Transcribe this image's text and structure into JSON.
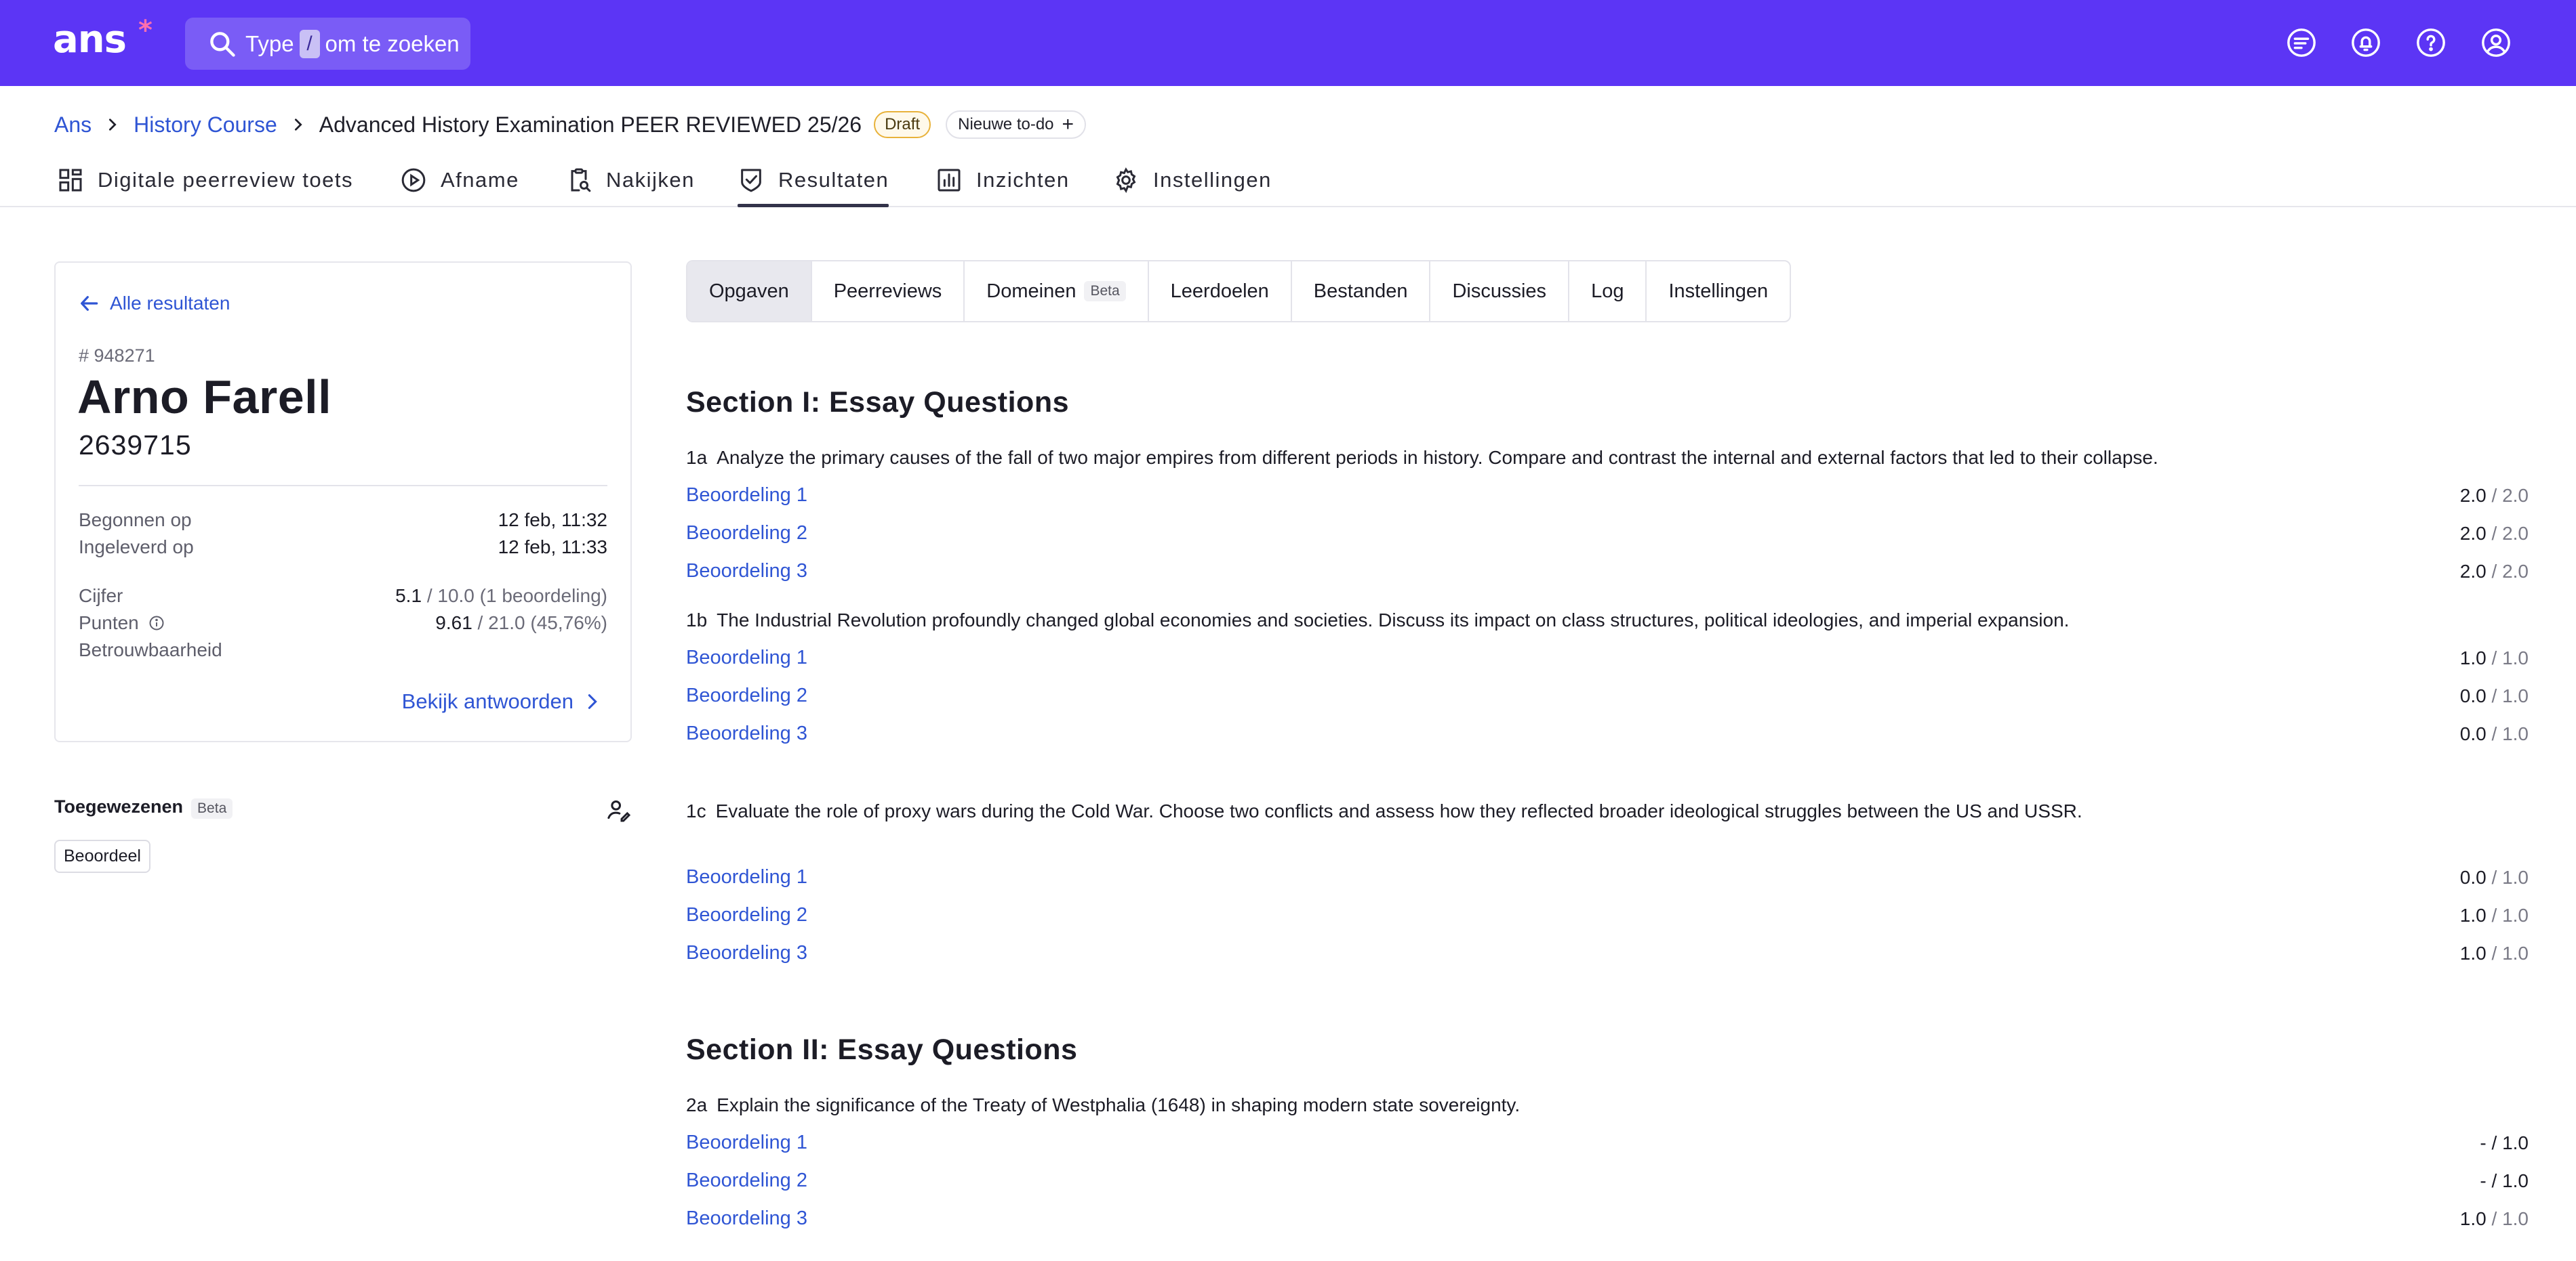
{
  "topbar": {
    "logo": "ans",
    "logo_star": "*",
    "search_prefix": "Type",
    "search_key": "/",
    "search_suffix": "om te zoeken",
    "brand_color": "#5c35f5",
    "icons": [
      "feedback-icon",
      "notifications-icon",
      "help-icon",
      "account-icon"
    ]
  },
  "breadcrumb": {
    "root": "Ans",
    "course": "History Course",
    "current": "Advanced History Examination PEER REVIEWED 25/26",
    "status": "Draft",
    "todo_label": "Nieuwe to-do",
    "todo_plus": "+"
  },
  "nav": {
    "items": [
      {
        "label": "Digitale peerreview toets",
        "icon": "grid-icon"
      },
      {
        "label": "Afname",
        "icon": "play-icon"
      },
      {
        "label": "Nakijken",
        "icon": "clipboard-search-icon"
      },
      {
        "label": "Resultaten",
        "icon": "shield-check-icon"
      },
      {
        "label": "Inzichten",
        "icon": "bar-chart-icon"
      },
      {
        "label": "Instellingen",
        "icon": "gear-icon"
      }
    ],
    "active": "Resultaten"
  },
  "student": {
    "back_label": "Alle resultaten",
    "id": "# 948271",
    "name": "Arno Farell",
    "number": "2639715",
    "started_label": "Begonnen op",
    "started_value": "12 feb, 11:32",
    "submitted_label": "Ingeleverd op",
    "submitted_value": "12 feb, 11:33",
    "grade_label": "Cijfer",
    "grade_value": "5.1",
    "grade_rest": "/ 10.0 (1 beoordeling)",
    "points_label": "Punten",
    "points_value": "9.61",
    "points_rest": "/ 21.0 (45,76%)",
    "reliability_label": "Betrouwbaarheid",
    "view_answers": "Bekijk antwoorden"
  },
  "assigned": {
    "title": "Toegewezenen",
    "beta": "Beta",
    "chip": "Beoordeel"
  },
  "tabs": {
    "items": [
      "Opgaven",
      "Peerreviews",
      "Domeinen",
      "Leerdoelen",
      "Bestanden",
      "Discussies",
      "Log",
      "Instellingen"
    ],
    "domain_badge": "Beta",
    "active": "Opgaven"
  },
  "sections": [
    {
      "title": "Section I: Essay Questions",
      "questions": [
        {
          "num": "1a",
          "text": "Analyze the primary causes of the fall of two major empires from different periods in history. Compare and contrast the internal and external factors that led to their collapse.",
          "reviews": [
            {
              "label": "Beoordeling 1",
              "score": "2.0",
              "max": "/ 2.0"
            },
            {
              "label": "Beoordeling 2",
              "score": "2.0",
              "max": "/ 2.0"
            },
            {
              "label": "Beoordeling 3",
              "score": "2.0",
              "max": "/ 2.0"
            }
          ]
        },
        {
          "num": "1b",
          "text": "The Industrial Revolution profoundly changed global economies and societies. Discuss its impact on class structures, political ideologies, and imperial expansion.",
          "reviews": [
            {
              "label": "Beoordeling 1",
              "score": "1.0",
              "max": "/ 1.0"
            },
            {
              "label": "Beoordeling 2",
              "score": "0.0",
              "max": "/ 1.0"
            },
            {
              "label": "Beoordeling 3",
              "score": "0.0",
              "max": "/ 1.0"
            }
          ]
        },
        {
          "num": "1c",
          "text": "Evaluate the role of proxy wars during the Cold War. Choose two conflicts and assess how they reflected broader ideological struggles between the US and USSR.",
          "reviews": [
            {
              "label": "Beoordeling 1",
              "score": "0.0",
              "max": "/ 1.0"
            },
            {
              "label": "Beoordeling 2",
              "score": "1.0",
              "max": "/ 1.0"
            },
            {
              "label": "Beoordeling 3",
              "score": "1.0",
              "max": "/ 1.0"
            }
          ]
        }
      ]
    },
    {
      "title": "Section II: Essay Questions",
      "questions": [
        {
          "num": "2a",
          "text": "Explain the significance of the Treaty of Westphalia (1648) in shaping modern state sovereignty.",
          "reviews": [
            {
              "label": "Beoordeling 1",
              "score": "- / 1.0",
              "max": ""
            },
            {
              "label": "Beoordeling 2",
              "score": "- / 1.0",
              "max": ""
            },
            {
              "label": "Beoordeling 3",
              "score": "1.0",
              "max": "/ 1.0"
            }
          ]
        }
      ]
    }
  ]
}
